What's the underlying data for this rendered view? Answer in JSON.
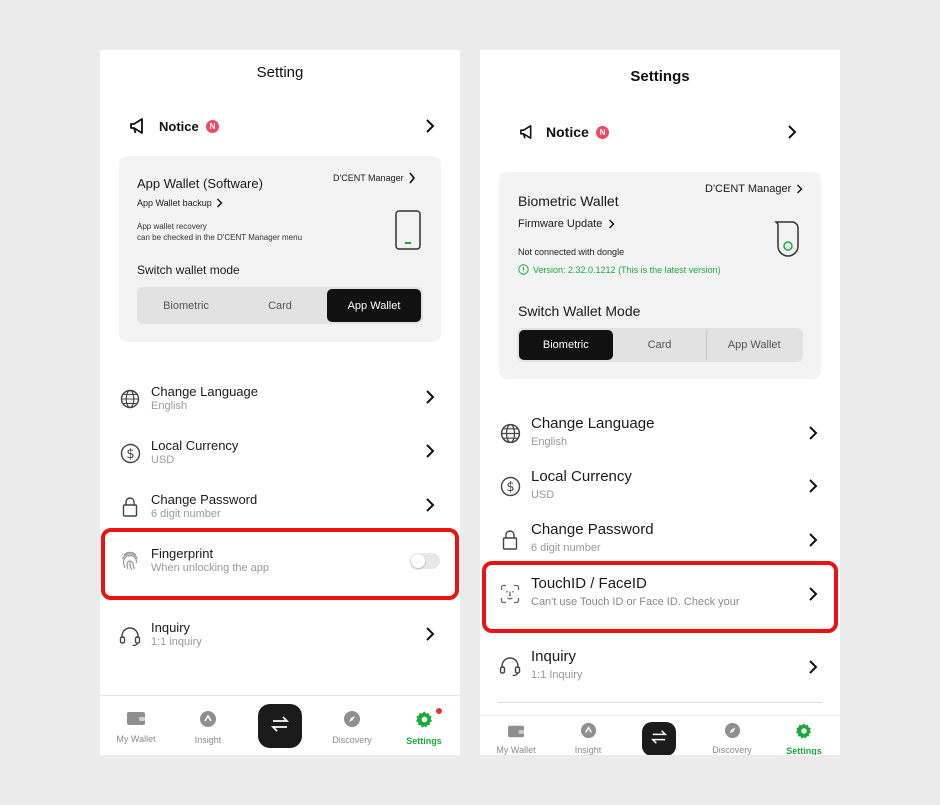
{
  "left": {
    "title": "Setting",
    "notice": {
      "label": "Notice",
      "badge": "N"
    },
    "wallet_card": {
      "heading": "App Wallet (Software)",
      "manager_link": "D'CENT Manager",
      "backup_link": "App Wallet backup",
      "info_line1": "App wallet recovery",
      "info_line2": "can be checked in the D'CENT Manager menu",
      "mode_label": "Switch wallet mode",
      "modes": [
        "Biometric",
        "Card",
        "App Wallet"
      ],
      "active_mode": "App Wallet"
    },
    "items": [
      {
        "label": "Change Language",
        "sub": "English",
        "icon": "globe-icon"
      },
      {
        "label": "Local Currency",
        "sub": "USD",
        "icon": "dollar-icon"
      },
      {
        "label": "Change Password",
        "sub": "6 digit number",
        "icon": "lock-icon"
      },
      {
        "label": "Fingerprint",
        "sub": "When unlocking the app",
        "icon": "fingerprint-icon",
        "toggle": false
      },
      {
        "label": "Inquiry",
        "sub": "1:1 inquiry",
        "icon": "headset-icon"
      }
    ],
    "tabs": [
      {
        "label": "My Wallet",
        "icon": "wallet-icon"
      },
      {
        "label": "Insight",
        "icon": "insight-icon"
      },
      {
        "label": "",
        "icon": "swap-icon"
      },
      {
        "label": "Discovery",
        "icon": "compass-icon"
      },
      {
        "label": "Settings",
        "icon": "gear-icon"
      }
    ]
  },
  "right": {
    "title": "Settings",
    "notice": {
      "label": "Notice",
      "badge": "N"
    },
    "wallet_card": {
      "heading": "Biometric Wallet",
      "manager_link": "D'CENT Manager",
      "firmware_link": "Firmware Update",
      "status": "Not connected with dongle",
      "version": "Version: 2.32.0.1212 (This is the latest version)",
      "mode_label": "Switch Wallet Mode",
      "modes": [
        "Biometric",
        "Card",
        "App Wallet"
      ],
      "active_mode": "Biometric"
    },
    "items": [
      {
        "label": "Change Language",
        "sub": "English",
        "icon": "globe-icon"
      },
      {
        "label": "Local Currency",
        "sub": "USD",
        "icon": "dollar-icon"
      },
      {
        "label": "Change Password",
        "sub": "6 digit number",
        "icon": "lock-icon"
      },
      {
        "label": "TouchID / FaceID",
        "sub": "Can't use Touch ID or Face ID. Check your",
        "icon": "faceid-icon"
      },
      {
        "label": "Inquiry",
        "sub": "1:1 Inquiry",
        "icon": "headset-icon"
      }
    ],
    "tabs": [
      {
        "label": "My Wallet",
        "icon": "wallet-icon"
      },
      {
        "label": "Insight",
        "icon": "insight-icon"
      },
      {
        "label": "",
        "icon": "swap-icon"
      },
      {
        "label": "Discovery",
        "icon": "compass-icon"
      },
      {
        "label": "Settings",
        "icon": "gear-icon"
      }
    ]
  },
  "colors": {
    "accent_green": "#1aaa3a",
    "highlight_red": "#ee1111",
    "badge_red": "#f14a5e"
  }
}
